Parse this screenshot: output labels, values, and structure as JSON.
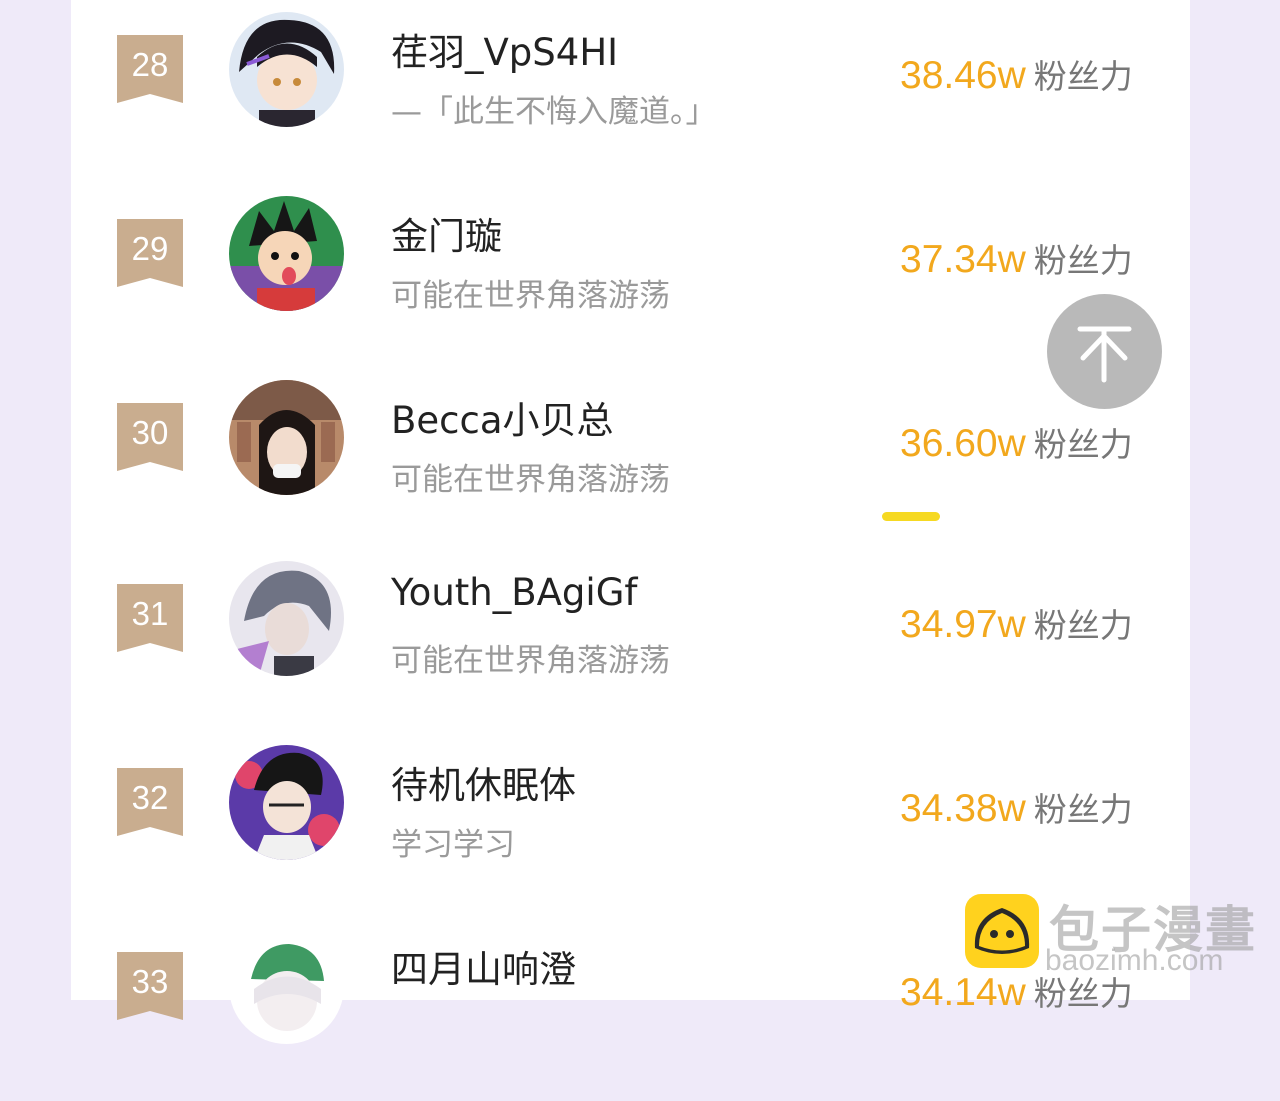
{
  "unit_label": "粉丝力",
  "colors": {
    "page_bg": "#efeaf9",
    "rank_badge": "#c9ad8f",
    "score": "#f2a81d",
    "highlight_bar": "#f6d922",
    "back_to_top": "#b9b9b9"
  },
  "rows": [
    {
      "rank": "28",
      "name": "荏羽_VpS4HI",
      "signature": "—「此生不悔入魔道。」",
      "score": "38.46w"
    },
    {
      "rank": "29",
      "name": "金门璇",
      "signature": "可能在世界角落游荡",
      "score": "37.34w"
    },
    {
      "rank": "30",
      "name": "Becca小贝总",
      "signature": "可能在世界角落游荡",
      "score": "36.60w"
    },
    {
      "rank": "31",
      "name": "Youth_BAgiGf",
      "signature": "可能在世界角落游荡",
      "score": "34.97w"
    },
    {
      "rank": "32",
      "name": "待机休眠体",
      "signature": "学习学习",
      "score": "34.38w"
    },
    {
      "rank": "33",
      "name": "四月山响澄",
      "signature": "",
      "score": "34.14w"
    }
  ],
  "back_to_top_icon": "arrow-up-icon",
  "watermark": {
    "cn": "包子漫畫",
    "en": "baozimh.com",
    "icon": "bun-logo-icon"
  }
}
